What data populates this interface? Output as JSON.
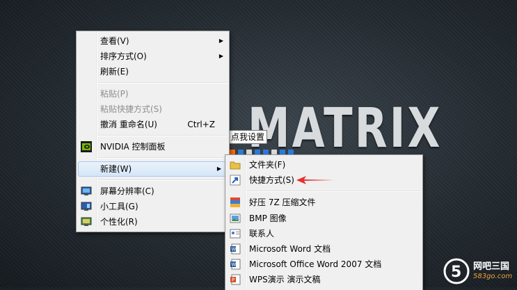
{
  "wallpaper": {
    "title": "MATRIX"
  },
  "tooltip": {
    "text": "点我设置"
  },
  "context_menu": {
    "view": "查看(V)",
    "sort": "排序方式(O)",
    "refresh": "刷新(E)",
    "paste": "粘贴(P)",
    "paste_shortcut": "粘贴快捷方式(S)",
    "undo": "撤消 重命名(U)",
    "undo_shortcut": "Ctrl+Z",
    "nvidia": "NVIDIA 控制面板",
    "new": "新建(W)",
    "resolution": "屏幕分辨率(C)",
    "gadgets": "小工具(G)",
    "personalize": "个性化(R)"
  },
  "new_submenu": {
    "folder": "文件夹(F)",
    "shortcut": "快捷方式(S)",
    "haozip": "好压 7Z 压缩文件",
    "bmp": "BMP 图像",
    "contact": "联系人",
    "word": "Microsoft Word 文档",
    "word2007": "Microsoft Office Word 2007 文档",
    "wps": "WPS演示 演示文稿"
  },
  "watermark": {
    "name": "网吧三国",
    "site": "583go.com"
  },
  "colors": {
    "highlight_border": "#a8c8ec",
    "arrow_red": "#e53030",
    "accent_orange": "#e9a43a"
  }
}
